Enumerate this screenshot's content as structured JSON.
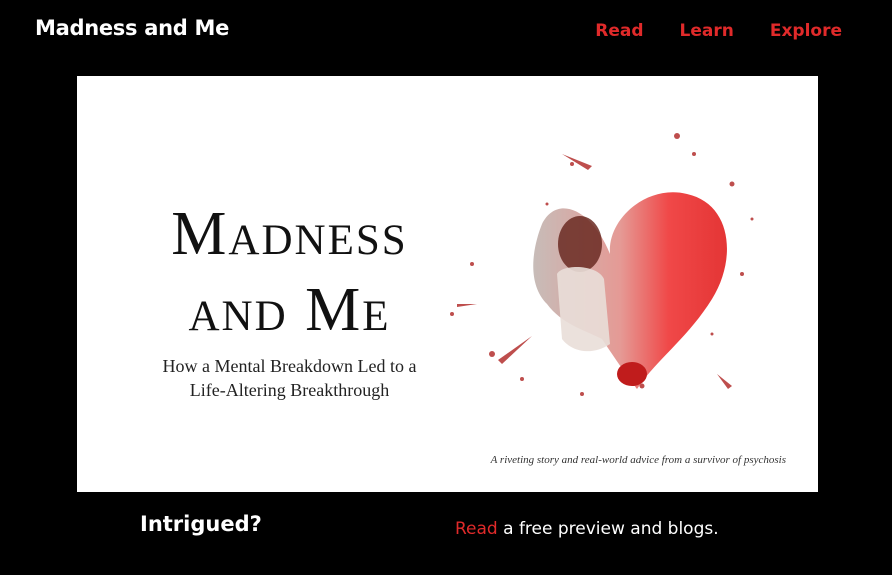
{
  "site": {
    "title": "Madness and Me"
  },
  "nav": {
    "items": [
      "Read",
      "Learn",
      "Explore"
    ]
  },
  "banner": {
    "title_line1": "Madness",
    "title_line2": "and Me",
    "subtitle_line1": "How a Mental Breakdown Led to a",
    "subtitle_line2": "Life-Altering Breakthrough",
    "tagline": "A riveting story and real-world advice from a survivor of psychosis"
  },
  "footer": {
    "heading": "Intrigued?",
    "link_text": "Read",
    "text": " a free preview and blogs."
  },
  "colors": {
    "accent": "#e02a2a",
    "background": "#000000"
  }
}
